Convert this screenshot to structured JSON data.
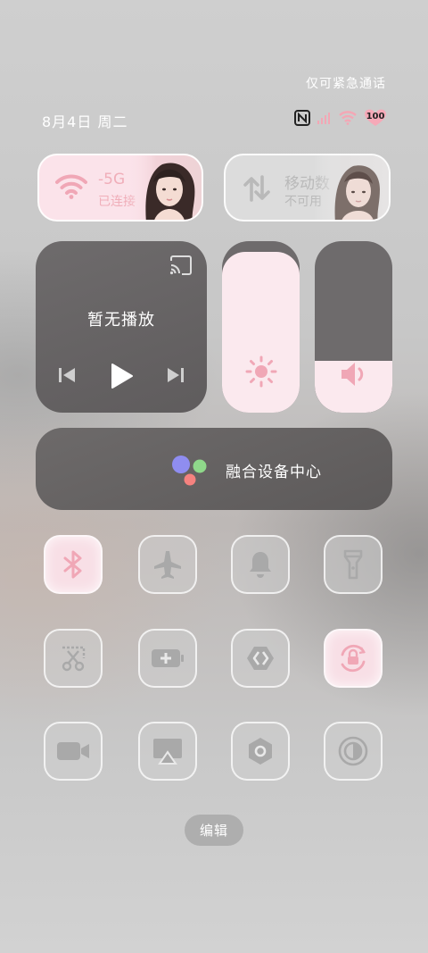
{
  "status": {
    "emergency_text": "仅可紧急通话",
    "date_text": "8月4日 周二",
    "battery_level": "100",
    "icons": [
      "nfc-icon",
      "signal-icon",
      "wifi-status-icon",
      "battery-icon"
    ]
  },
  "wifi": {
    "title": "-5G",
    "subtitle": "已连接",
    "icon": "wifi-icon"
  },
  "mobile": {
    "title": "移动数",
    "subtitle": "不可用",
    "icon": "data-arrows-icon"
  },
  "media": {
    "status_text": "暂无播放"
  },
  "sliders": {
    "brightness_level": 0.94,
    "volume_level": 0.3
  },
  "device_center": {
    "label": "融合设备中心"
  },
  "toggles": [
    {
      "name": "bluetooth",
      "icon": "bluetooth-icon",
      "on": true
    },
    {
      "name": "airplane-mode",
      "icon": "airplane-icon",
      "on": false
    },
    {
      "name": "ring",
      "icon": "bell-icon",
      "on": false
    },
    {
      "name": "flashlight",
      "icon": "flashlight-icon",
      "on": false
    },
    {
      "name": "screenshot",
      "icon": "scissors-icon",
      "on": false
    },
    {
      "name": "battery-saver",
      "icon": "battery-plus-icon",
      "on": false
    },
    {
      "name": "code",
      "icon": "code-icon",
      "on": false
    },
    {
      "name": "rotation-lock",
      "icon": "rotation-lock-icon",
      "on": true
    },
    {
      "name": "screen-record",
      "icon": "video-camera-icon",
      "on": false
    },
    {
      "name": "screen-cast",
      "icon": "airplay-icon",
      "on": false
    },
    {
      "name": "settings-hex",
      "icon": "hexagon-icon",
      "on": false
    },
    {
      "name": "dark-mode",
      "icon": "contrast-icon",
      "on": false
    }
  ],
  "edit_label": "编辑",
  "colors": {
    "accent_pink": "#f0a7b6",
    "tile_on": "#f8dfe6",
    "dark_tile": "#6e6b6c"
  }
}
